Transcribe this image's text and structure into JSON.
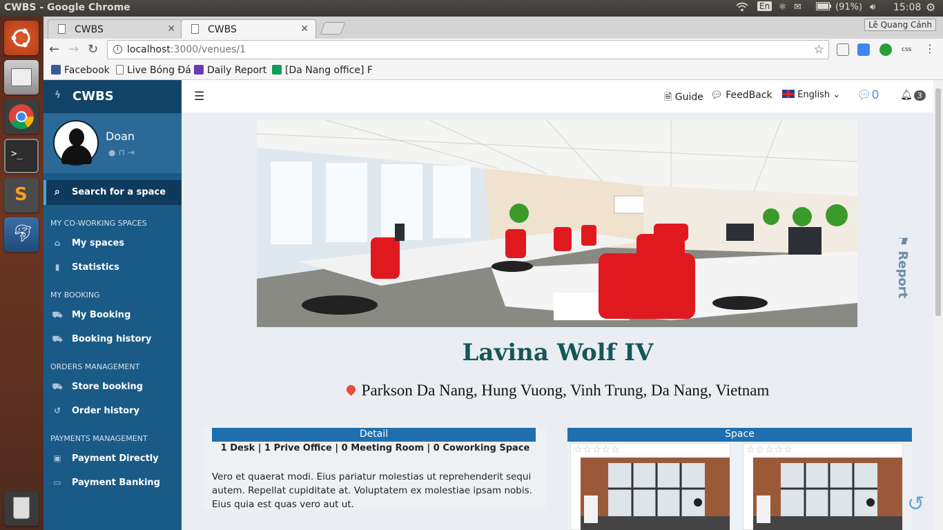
{
  "os": {
    "window_title": "CWBS - Google Chrome",
    "keyboard": "En",
    "battery": "(91%)",
    "time": "15:08"
  },
  "browser": {
    "tabs": [
      {
        "label": "CWBS",
        "active": false
      },
      {
        "label": "CWBS",
        "active": true
      }
    ],
    "profile": "Lê Quang Cảnh",
    "url_host": "localhost",
    "url_path": ":3000/venues/1",
    "bookmarks": [
      {
        "label": "Facebook",
        "icon": "facebook-icon",
        "color": "#3b5998"
      },
      {
        "label": "Live Bóng Đá",
        "icon": "page-icon",
        "color": "#ffffff"
      },
      {
        "label": "Daily Report",
        "icon": "form-icon",
        "color": "#673ab7"
      },
      {
        "label": "[Da Nang office] F",
        "icon": "sheets-icon",
        "color": "#0f9d58"
      }
    ]
  },
  "sidebar": {
    "brand": "CWBS",
    "user": "Doan",
    "search_label": "Search for a space",
    "sections": [
      {
        "title": "MY CO-WORKING SPACES",
        "items": [
          {
            "label": "My spaces",
            "icon": "home-icon"
          },
          {
            "label": "Statistics",
            "icon": "bar-chart-icon"
          }
        ]
      },
      {
        "title": "MY BOOKING",
        "items": [
          {
            "label": "My Booking",
            "icon": "cart-icon"
          },
          {
            "label": "Booking history",
            "icon": "cart-icon"
          }
        ]
      },
      {
        "title": "ORDERS MANAGEMENT",
        "items": [
          {
            "label": "Store booking",
            "icon": "cart-icon"
          },
          {
            "label": "Order history",
            "icon": "history-icon"
          }
        ]
      },
      {
        "title": "PAYMENTS MANAGEMENT",
        "items": [
          {
            "label": "Payment Directly",
            "icon": "money-icon"
          },
          {
            "label": "Payment Banking",
            "icon": "credit-card-icon"
          }
        ]
      }
    ]
  },
  "topnav": {
    "guide": "Guide",
    "feedback": "FeedBack",
    "language": "English",
    "messages_count": "0",
    "notifications_count": "3"
  },
  "venue": {
    "name": "Lavina Wolf IV",
    "address": "Parkson Da Nang, Hung Vuong, Vinh Trung, Da Nang, Vietnam",
    "report_label": "Report",
    "detail": {
      "header": "Detail",
      "counts": "1 Desk | 1 Prive Office | 0 Meeting Room | 0 Coworking Space",
      "description": "Vero et quaerat modi. Eius pariatur molestias ut reprehenderit sequi autem. Repellat cupiditate at. Voluptatem ex molestiae ipsam nobis. Eius quia est quas vero aut ut."
    },
    "space": {
      "header": "Space",
      "cards": [
        {
          "rating": 0,
          "stars": "☆☆☆☆☆"
        },
        {
          "rating": 0,
          "stars": "☆☆☆☆☆"
        }
      ]
    }
  },
  "colors": {
    "sidebar": "#1a5a87",
    "sidebar_dark": "#124469",
    "accent": "#1f6fae",
    "title": "#15575b"
  }
}
